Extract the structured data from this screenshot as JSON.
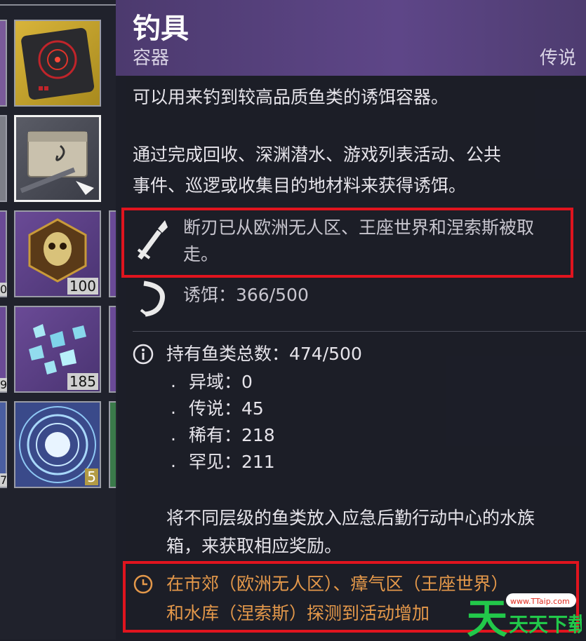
{
  "inventory": {
    "counts": {
      "mask": "100",
      "crystals": "185",
      "orb": "5",
      "edge1": "0",
      "edge2": "9",
      "edge3": "7"
    }
  },
  "tooltip": {
    "title": "钓具",
    "subtype": "容器",
    "rarity": "传说",
    "description": "可以用来钓到较高品质鱼类的诱饵容器。",
    "acquire_line1": "通过完成回收、深渊潜水、游戏列表活动、公共",
    "acquire_line2": "事件、巡逻或收集目的地材料来获得诱饵。",
    "warning_line1": "断刃已从欧洲无人区、王座世界和涅索斯被取",
    "warning_line2": "走。",
    "bait_label": "诱饵：366/500",
    "fish_total_label": "持有鱼类总数：474/500",
    "fish_breakdown": [
      {
        "label": "异域：0"
      },
      {
        "label": "传说：45"
      },
      {
        "label": "稀有：218"
      },
      {
        "label": "罕见：211"
      }
    ],
    "aquarium_line1": "将不同层级的鱼类放入应急后勤行动中心的水族",
    "aquarium_line2": "箱，来获取相应奖励。",
    "event_line1": "在市郊（欧洲无人区）、瘴气区（王座世界）",
    "event_line2": "和水库（涅索斯）探测到活动增加"
  },
  "watermark": {
    "url": "www.TTaip.com",
    "text": "天天下载"
  },
  "colors": {
    "header": "#5e4688",
    "highlight_border": "#e0141e",
    "event_text": "#e4984a",
    "legendary": "#6a4a96"
  },
  "icons": [
    "blade-broken-icon",
    "bait-shrimp-icon",
    "info-circle-icon",
    "clock-icon",
    "cursor-arrow-icon"
  ]
}
